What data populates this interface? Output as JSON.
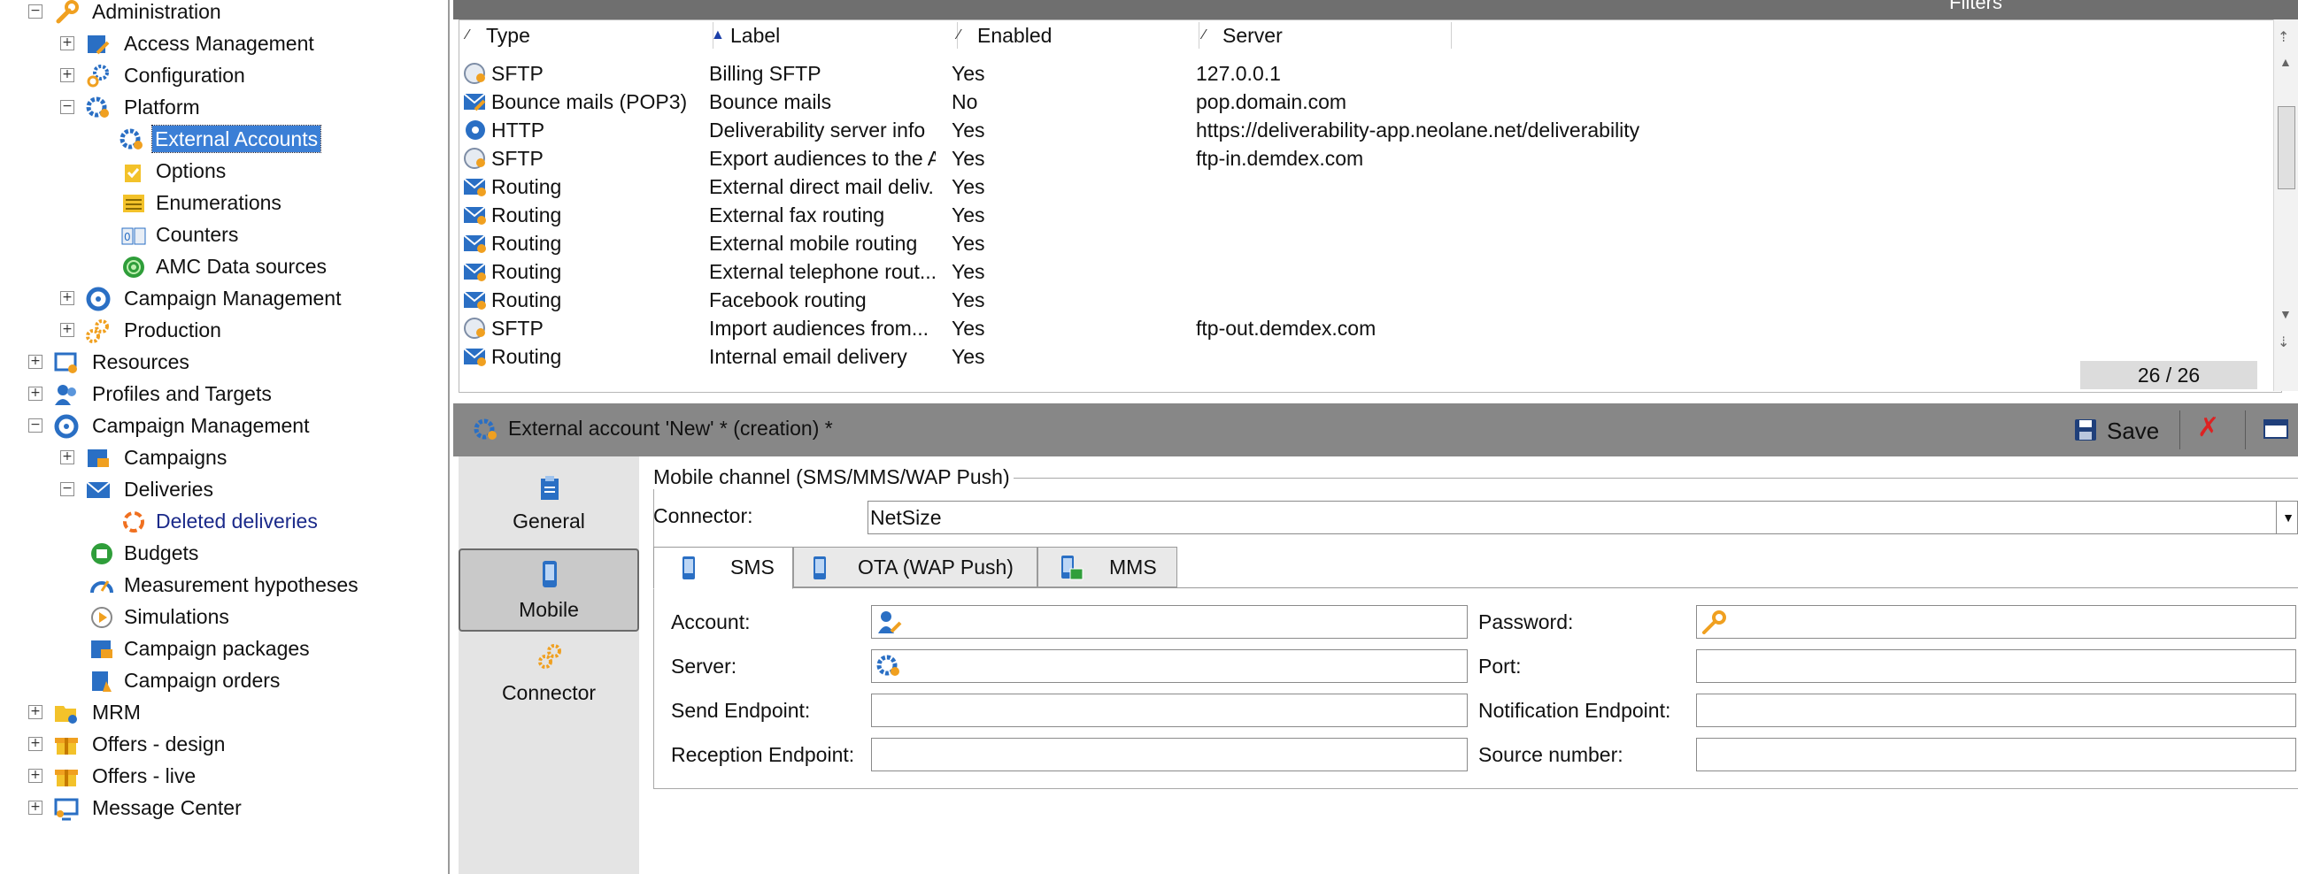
{
  "tree": {
    "items": [
      {
        "label": "Administration",
        "toggle": "−",
        "icon": "wrench-icon"
      },
      {
        "label": "Access Management",
        "toggle": "+",
        "icon": "access-management-icon"
      },
      {
        "label": "Configuration",
        "toggle": "+",
        "icon": "gears-icon"
      },
      {
        "label": "Platform",
        "toggle": "−",
        "icon": "platform-gear-icon"
      },
      {
        "label": "External Accounts",
        "icon": "external-account-gear-icon"
      },
      {
        "label": "Options",
        "icon": "options-icon"
      },
      {
        "label": "Enumerations",
        "icon": "enumerations-icon"
      },
      {
        "label": "Counters",
        "icon": "counters-icon"
      },
      {
        "label": "AMC Data sources",
        "icon": "amc-data-sources-icon"
      },
      {
        "label": "Campaign Management",
        "toggle": "+",
        "icon": "campaign-management-icon"
      },
      {
        "label": "Production",
        "toggle": "+",
        "icon": "production-gears-icon"
      },
      {
        "label": "Resources",
        "toggle": "+",
        "icon": "resources-icon"
      },
      {
        "label": "Profiles and Targets",
        "toggle": "+",
        "icon": "profiles-icon"
      },
      {
        "label": "Campaign Management",
        "toggle": "−",
        "icon": "campaign-management-icon"
      },
      {
        "label": "Campaigns",
        "toggle": "+",
        "icon": "campaigns-icon"
      },
      {
        "label": "Deliveries",
        "toggle": "−",
        "icon": "deliveries-envelope-icon"
      },
      {
        "label": "Deleted deliveries",
        "icon": "deleted-deliveries-icon"
      },
      {
        "label": "Budgets",
        "icon": "budgets-icon"
      },
      {
        "label": "Measurement hypotheses",
        "icon": "measurement-hypotheses-icon"
      },
      {
        "label": "Simulations",
        "icon": "simulations-icon"
      },
      {
        "label": "Campaign packages",
        "icon": "campaign-packages-icon"
      },
      {
        "label": "Campaign orders",
        "icon": "campaign-orders-icon"
      },
      {
        "label": "MRM",
        "toggle": "+",
        "icon": "mrm-folder-icon"
      },
      {
        "label": "Offers - design",
        "toggle": "+",
        "icon": "offers-design-icon"
      },
      {
        "label": "Offers - live",
        "toggle": "+",
        "icon": "offers-live-icon"
      },
      {
        "label": "Message Center",
        "toggle": "+",
        "icon": "message-center-icon"
      }
    ]
  },
  "list": {
    "columns": {
      "type": "Type",
      "label": "Label",
      "enabled": "Enabled",
      "server": "Server"
    },
    "rows": [
      {
        "type": "SFTP",
        "label": "Billing SFTP",
        "enabled": "Yes",
        "server": "127.0.0.1",
        "icon": "sftp-globe-icon"
      },
      {
        "type": "Bounce mails (POP3)",
        "label": "Bounce mails",
        "enabled": "No",
        "server": "pop.domain.com",
        "icon": "bounce-mail-icon"
      },
      {
        "type": "HTTP",
        "label": "Deliverability server info",
        "enabled": "Yes",
        "server": "https://deliverability-app.neolane.net/deliverability",
        "icon": "http-icon"
      },
      {
        "type": "SFTP",
        "label": "Export audiences to the A",
        "enabled": "Yes",
        "server": "ftp-in.demdex.com",
        "icon": "sftp-globe-icon"
      },
      {
        "type": "Routing",
        "label": "External direct mail deliv...",
        "enabled": "Yes",
        "server": "",
        "icon": "routing-icon"
      },
      {
        "type": "Routing",
        "label": "External fax routing",
        "enabled": "Yes",
        "server": "",
        "icon": "routing-icon"
      },
      {
        "type": "Routing",
        "label": "External mobile routing",
        "enabled": "Yes",
        "server": "",
        "icon": "routing-icon"
      },
      {
        "type": "Routing",
        "label": "External telephone rout...",
        "enabled": "Yes",
        "server": "",
        "icon": "routing-icon"
      },
      {
        "type": "Routing",
        "label": "Facebook routing",
        "enabled": "Yes",
        "server": "",
        "icon": "routing-icon"
      },
      {
        "type": "SFTP",
        "label": "Import audiences from...",
        "enabled": "Yes",
        "server": "ftp-out.demdex.com",
        "icon": "sftp-globe-icon"
      },
      {
        "type": "Routing",
        "label": "Internal email delivery",
        "enabled": "Yes",
        "server": "",
        "icon": "routing-icon"
      }
    ],
    "count": "26 / 26",
    "filters_label": "Filters"
  },
  "detail": {
    "title": "External account 'New' * (creation) *",
    "save_label": "Save",
    "nav": [
      {
        "label": "General",
        "icon": "clipboard-icon"
      },
      {
        "label": "Mobile",
        "icon": "mobile-phone-icon"
      },
      {
        "label": "Connector",
        "icon": "connector-gears-icon"
      }
    ],
    "group_title": "Mobile channel (SMS/MMS/WAP Push)",
    "connector_label": "Connector:",
    "connector_value": "NetSize",
    "tabs": [
      {
        "label": "SMS",
        "icon": "phone-icon"
      },
      {
        "label": "OTA (WAP Push)",
        "icon": "phone-icon"
      },
      {
        "label": "MMS",
        "icon": "mms-icon"
      }
    ],
    "fields": {
      "account": "Account:",
      "password": "Password:",
      "server": "Server:",
      "port": "Port:",
      "send_endpoint": "Send Endpoint:",
      "notification_endpoint": "Notification Endpoint:",
      "reception_endpoint": "Reception Endpoint:",
      "source_number": "Source number:"
    }
  }
}
